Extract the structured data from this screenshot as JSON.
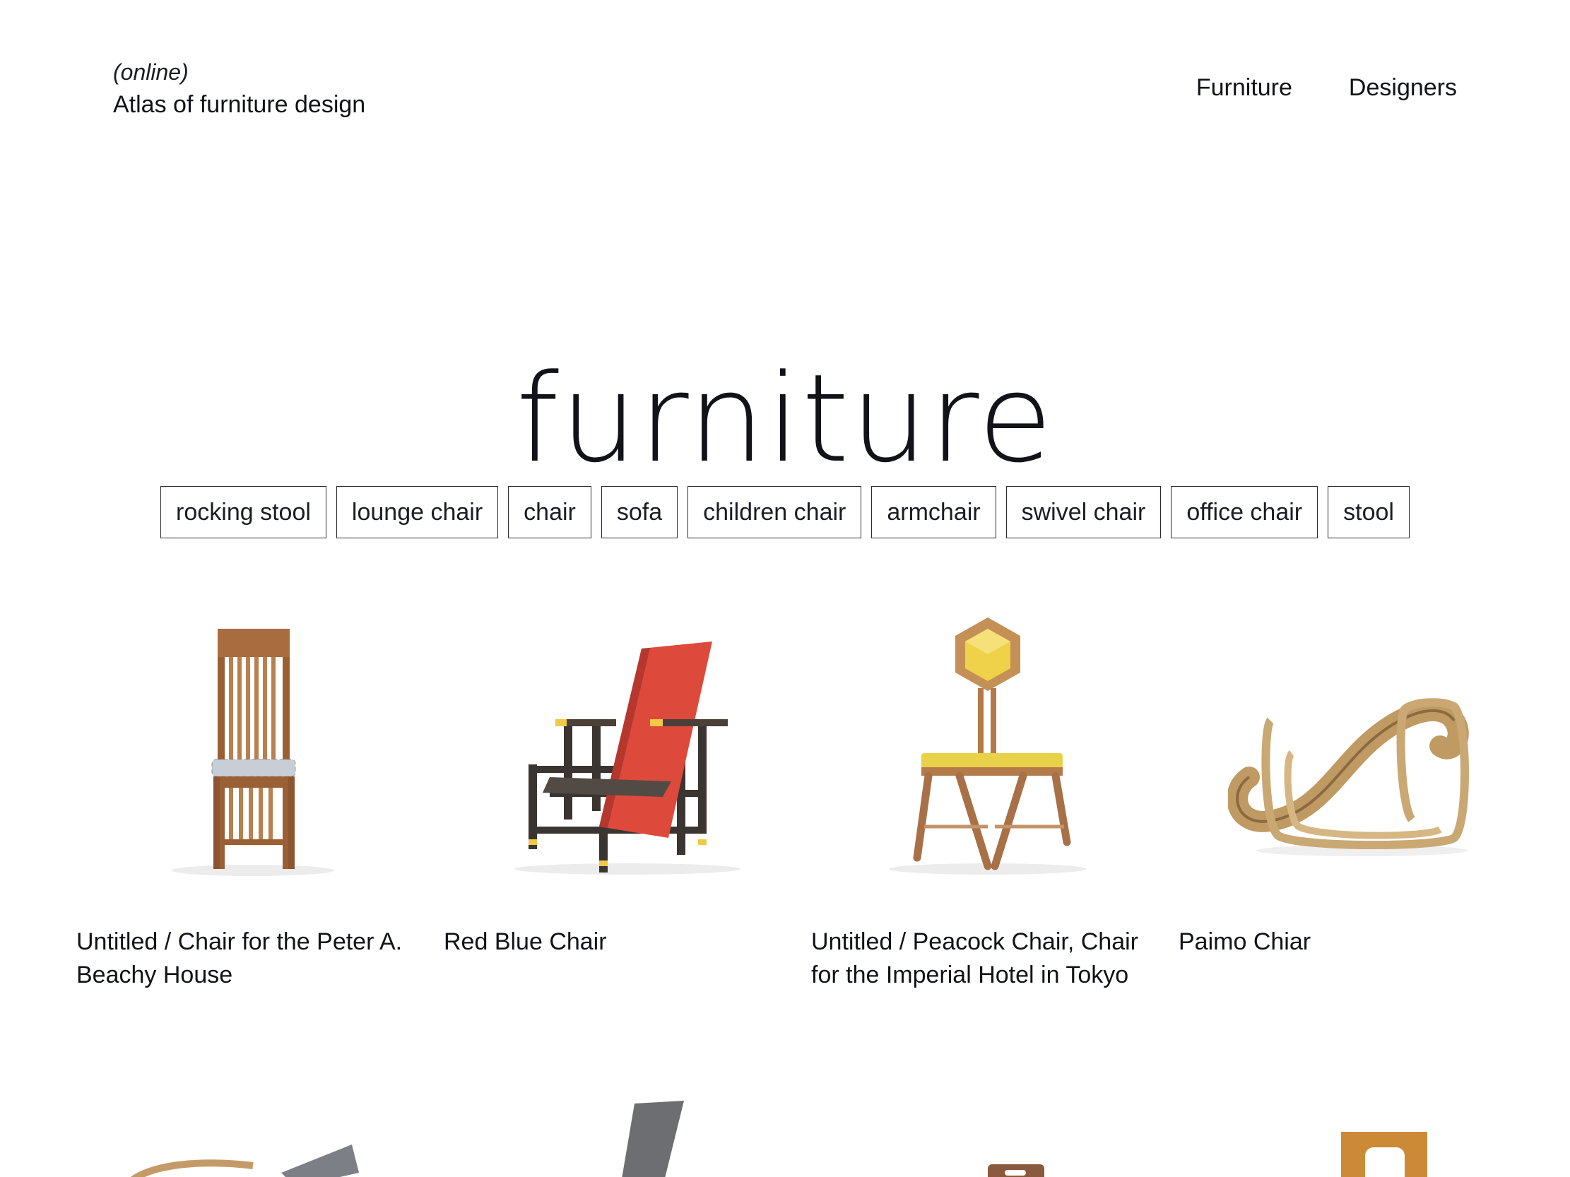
{
  "header": {
    "brand_sub": "(online)",
    "brand_title": "Atlas of furniture design",
    "nav": [
      {
        "label": "Furniture"
      },
      {
        "label": "Designers"
      }
    ]
  },
  "hero": {
    "title": "furniture"
  },
  "filters": [
    "rocking stool",
    "lounge chair",
    "chair",
    "sofa",
    "children chair",
    "armchair",
    "swivel chair",
    "office chair",
    "stool"
  ],
  "items": [
    {
      "title": "Untitled / Chair for the Peter A. Beachy House",
      "image": "high-back-oak-chair"
    },
    {
      "title": "Red Blue Chair",
      "image": "red-blue-chair"
    },
    {
      "title": "Untitled / Peacock Chair, Chair for the Imperial Hotel in Tokyo",
      "image": "peacock-chair"
    },
    {
      "title": "Paimo Chiar",
      "image": "paimio-chair"
    }
  ],
  "colors": {
    "text": "#111318",
    "background": "#ffffff",
    "red": "#e0463c",
    "yellow": "#f0d24a",
    "wood": "#b57a4a"
  }
}
